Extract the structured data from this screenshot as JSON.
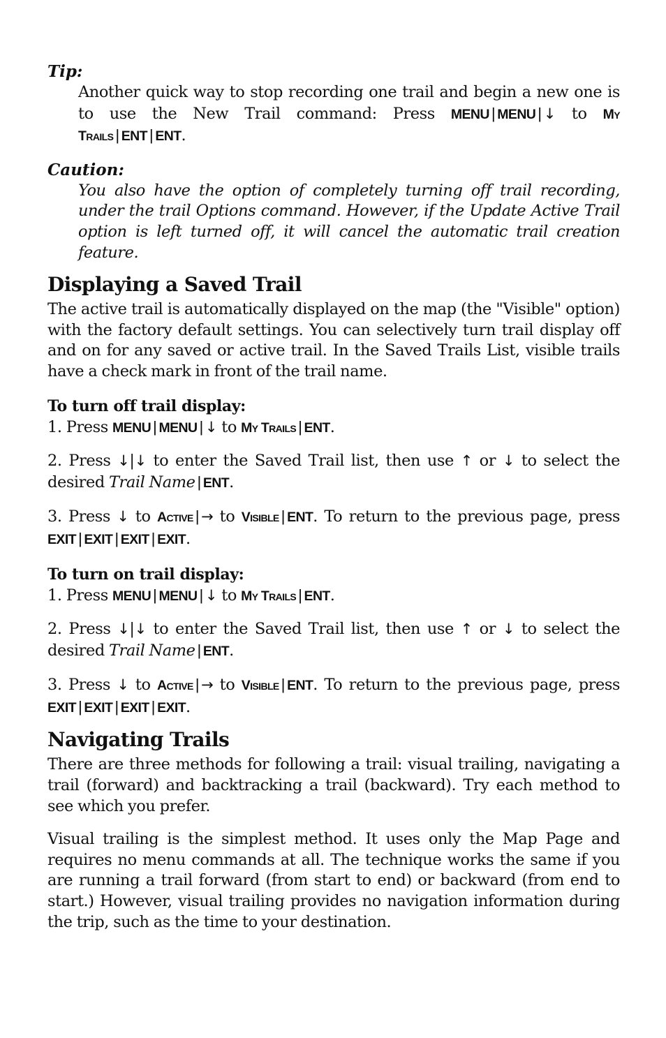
{
  "tip": {
    "label": "Tip:",
    "runs": [
      {
        "t": "text",
        "v": "Another quick way to stop recording one trail and begin a new one is to use the New Trail command: Press "
      },
      {
        "t": "key",
        "v": "MENU"
      },
      {
        "t": "sep",
        "v": "|"
      },
      {
        "t": "key",
        "v": "MENU"
      },
      {
        "t": "sep",
        "v": "|"
      },
      {
        "t": "arrow",
        "v": "↓"
      },
      {
        "t": "text",
        "v": " to "
      },
      {
        "t": "sc",
        "v": "My Trails"
      },
      {
        "t": "sep",
        "v": "|"
      },
      {
        "t": "key",
        "v": "ENT"
      },
      {
        "t": "sep",
        "v": "|"
      },
      {
        "t": "key",
        "v": "ENT"
      },
      {
        "t": "text",
        "v": "."
      }
    ]
  },
  "caution": {
    "label": "Caution:",
    "text": "You also have the option of completely turning off trail recording, under the trail Options command. However, if the Update Active Trail option is left turned off, it will cancel the automatic trail creation feature."
  },
  "section1": {
    "heading": "Displaying a Saved Trail",
    "intro": "The active trail is automatically displayed on the map (the \"Visible\" option) with the factory default settings. You can selectively turn trail display off and on for any saved or active trail. In the Saved Trails List, visible trails have a check mark in front of the trail name.",
    "procedures": [
      {
        "title": "To turn off trail display:",
        "steps": [
          [
            {
              "t": "text",
              "v": "1. Press "
            },
            {
              "t": "key",
              "v": "MENU"
            },
            {
              "t": "sep",
              "v": "|"
            },
            {
              "t": "key",
              "v": "MENU"
            },
            {
              "t": "sep",
              "v": "|"
            },
            {
              "t": "arrow",
              "v": "↓"
            },
            {
              "t": "text",
              "v": " to "
            },
            {
              "t": "sc",
              "v": "My Trails"
            },
            {
              "t": "sep",
              "v": "|"
            },
            {
              "t": "key",
              "v": "ENT"
            },
            {
              "t": "text",
              "v": "."
            }
          ],
          [
            {
              "t": "text",
              "v": "2. Press "
            },
            {
              "t": "arrow",
              "v": "↓"
            },
            {
              "t": "text",
              "v": "|"
            },
            {
              "t": "arrow",
              "v": "↓"
            },
            {
              "t": "text",
              "v": " to enter the Saved Trail list, then use "
            },
            {
              "t": "arrow",
              "v": "↑"
            },
            {
              "t": "text",
              "v": " or "
            },
            {
              "t": "arrow",
              "v": "↓"
            },
            {
              "t": "text",
              "v": " to select the desired "
            },
            {
              "t": "it",
              "v": "Trail Name"
            },
            {
              "t": "sep",
              "v": "|"
            },
            {
              "t": "key",
              "v": "ENT"
            },
            {
              "t": "text",
              "v": "."
            }
          ],
          [
            {
              "t": "text",
              "v": "3. Press "
            },
            {
              "t": "arrow",
              "v": "↓"
            },
            {
              "t": "text",
              "v": " to "
            },
            {
              "t": "sc",
              "v": "Active"
            },
            {
              "t": "sep",
              "v": "|"
            },
            {
              "t": "arrow",
              "v": "→"
            },
            {
              "t": "text",
              "v": " to "
            },
            {
              "t": "sc",
              "v": "Visible"
            },
            {
              "t": "sep",
              "v": "|"
            },
            {
              "t": "key",
              "v": "ENT"
            },
            {
              "t": "text",
              "v": ". To return to the previous page, press  "
            },
            {
              "t": "key",
              "v": "EXIT"
            },
            {
              "t": "sep",
              "v": "|"
            },
            {
              "t": "key",
              "v": "EXIT"
            },
            {
              "t": "sep",
              "v": "|"
            },
            {
              "t": "key",
              "v": "EXIT"
            },
            {
              "t": "sep",
              "v": "|"
            },
            {
              "t": "key",
              "v": "EXIT"
            },
            {
              "t": "text",
              "v": "."
            }
          ]
        ]
      },
      {
        "title": "To turn on trail display:",
        "steps": [
          [
            {
              "t": "text",
              "v": "1. Press "
            },
            {
              "t": "key",
              "v": "MENU"
            },
            {
              "t": "sep",
              "v": "|"
            },
            {
              "t": "key",
              "v": "MENU"
            },
            {
              "t": "sep",
              "v": "|"
            },
            {
              "t": "arrow",
              "v": "↓"
            },
            {
              "t": "text",
              "v": " to "
            },
            {
              "t": "sc",
              "v": "My Trails"
            },
            {
              "t": "sep",
              "v": "|"
            },
            {
              "t": "key",
              "v": "ENT"
            },
            {
              "t": "text",
              "v": "."
            }
          ],
          [
            {
              "t": "text",
              "v": "2. Press "
            },
            {
              "t": "arrow",
              "v": "↓"
            },
            {
              "t": "text",
              "v": "|"
            },
            {
              "t": "arrow",
              "v": "↓"
            },
            {
              "t": "text",
              "v": " to enter the Saved Trail list, then use "
            },
            {
              "t": "arrow",
              "v": "↑"
            },
            {
              "t": "text",
              "v": " or "
            },
            {
              "t": "arrow",
              "v": "↓"
            },
            {
              "t": "text",
              "v": " to select the desired "
            },
            {
              "t": "it",
              "v": "Trail Name"
            },
            {
              "t": "sep",
              "v": "|"
            },
            {
              "t": "key",
              "v": "ENT"
            },
            {
              "t": "text",
              "v": "."
            }
          ],
          [
            {
              "t": "text",
              "v": "3. Press "
            },
            {
              "t": "arrow",
              "v": "↓"
            },
            {
              "t": "text",
              "v": " to "
            },
            {
              "t": "sc",
              "v": "Active"
            },
            {
              "t": "sep",
              "v": "|"
            },
            {
              "t": "arrow",
              "v": "→"
            },
            {
              "t": "text",
              "v": " to "
            },
            {
              "t": "sc",
              "v": "Visible"
            },
            {
              "t": "sep",
              "v": "|"
            },
            {
              "t": "key",
              "v": "ENT"
            },
            {
              "t": "text",
              "v": ". To return to the previous page, press  "
            },
            {
              "t": "key",
              "v": "EXIT"
            },
            {
              "t": "sep",
              "v": "|"
            },
            {
              "t": "key",
              "v": "EXIT"
            },
            {
              "t": "sep",
              "v": "|"
            },
            {
              "t": "key",
              "v": "EXIT"
            },
            {
              "t": "sep",
              "v": "|"
            },
            {
              "t": "key",
              "v": "EXIT"
            },
            {
              "t": "text",
              "v": "."
            }
          ]
        ]
      }
    ]
  },
  "section2": {
    "heading": "Navigating Trails",
    "paragraphs": [
      "There are three methods for following a trail: visual trailing, navigating a trail (forward) and backtracking a trail (backward). Try each method to see which you prefer.",
      "Visual trailing is the simplest method. It uses only the Map Page and requires no menu commands at all. The technique works the same if you are running a trail forward (from start to end) or backward (from end to start.) However, visual trailing provides no navigation information during the trip, such as the time to your destination."
    ]
  }
}
